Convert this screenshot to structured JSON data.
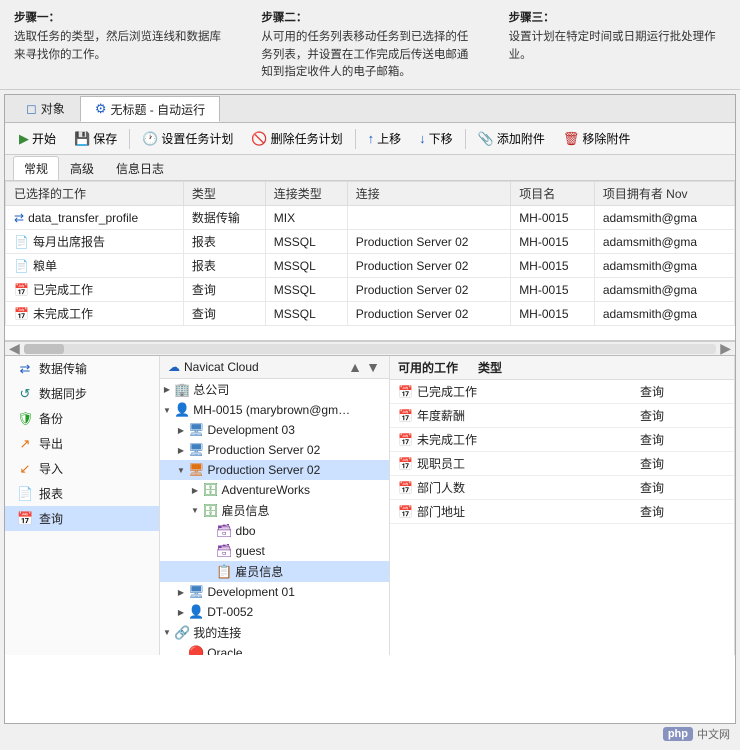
{
  "steps": [
    {
      "title": "步骤一：",
      "desc": "选取任务的类型，然后浏览连线和数据库来寻找你的工作。"
    },
    {
      "title": "步骤二：",
      "desc": "从可用的任务列表移动任务到已选择的任务列表，并设置在工作完成后传送电邮通知到指定收件人的电子邮箱。"
    },
    {
      "title": "步骤三：",
      "desc": "设置计划在特定时间或日期运行批处理作业。"
    }
  ],
  "tabs": [
    {
      "label": "对象",
      "icon": "◻"
    },
    {
      "label": "无标题 - 自动运行",
      "icon": "⚙"
    }
  ],
  "toolbar": {
    "buttons": [
      {
        "id": "start",
        "label": "开始",
        "icon": "▶"
      },
      {
        "id": "save",
        "label": "保存",
        "icon": "💾"
      },
      {
        "id": "set-schedule",
        "label": "设置任务计划",
        "icon": "🕐"
      },
      {
        "id": "del-schedule",
        "label": "删除任务计划",
        "icon": "🚫"
      },
      {
        "id": "move-up",
        "label": "上移",
        "icon": "↑"
      },
      {
        "id": "move-down",
        "label": "下移",
        "icon": "↓"
      },
      {
        "id": "add-attach",
        "label": "添加附件",
        "icon": "📎"
      },
      {
        "id": "remove-attach",
        "label": "移除附件",
        "icon": "🗑"
      }
    ]
  },
  "sub_tabs": [
    {
      "label": "常规",
      "active": true
    },
    {
      "label": "高级"
    },
    {
      "label": "信息日志"
    }
  ],
  "task_table": {
    "headers": [
      "已选择的工作",
      "类型",
      "连接类型",
      "连接",
      "项目名",
      "项目拥有者 Nov"
    ],
    "rows": [
      {
        "name": "data_transfer_profile",
        "type": "数据传输",
        "conn_type": "MIX",
        "connection": "",
        "project": "MH-0015",
        "owner": "adamsmith@gma",
        "icon": "transfer"
      },
      {
        "name": "每月出席报告",
        "type": "报表",
        "conn_type": "MSSQL",
        "connection": "Production Server 02",
        "project": "MH-0015",
        "owner": "adamsmith@gma",
        "icon": "report"
      },
      {
        "name": "粮单",
        "type": "报表",
        "conn_type": "MSSQL",
        "connection": "Production Server 02",
        "project": "MH-0015",
        "owner": "adamsmith@gma",
        "icon": "report"
      },
      {
        "name": "已完成工作",
        "type": "查询",
        "conn_type": "MSSQL",
        "connection": "Production Server 02",
        "project": "MH-0015",
        "owner": "adamsmith@gma",
        "icon": "query"
      },
      {
        "name": "未完成工作",
        "type": "查询",
        "conn_type": "MSSQL",
        "connection": "Production Server 02",
        "project": "MH-0015",
        "owner": "adamsmith@gma",
        "icon": "query"
      }
    ]
  },
  "sidebar": {
    "items": [
      {
        "id": "data-transfer",
        "label": "数据传输",
        "icon": "⇄",
        "selected": false
      },
      {
        "id": "data-sync",
        "label": "数据同步",
        "icon": "↺",
        "selected": false
      },
      {
        "id": "backup",
        "label": "备份",
        "icon": "🛡",
        "selected": false
      },
      {
        "id": "export",
        "label": "导出",
        "icon": "↗",
        "selected": false
      },
      {
        "id": "import",
        "label": "导入",
        "icon": "↙",
        "selected": false
      },
      {
        "id": "report",
        "label": "报表",
        "icon": "📄",
        "selected": false
      },
      {
        "id": "query",
        "label": "查询",
        "icon": "📅",
        "selected": true
      }
    ]
  },
  "tree": {
    "header": "Navicat Cloud",
    "nodes": [
      {
        "label": "总公司",
        "level": 1,
        "expanded": false,
        "icon": "🏢",
        "type": "company"
      },
      {
        "label": "MH-0015 (marybrown@gm…",
        "level": 1,
        "expanded": true,
        "icon": "👤",
        "type": "user"
      },
      {
        "label": "Development 03",
        "level": 2,
        "expanded": false,
        "icon": "🖥",
        "type": "server"
      },
      {
        "label": "Production Server 02",
        "level": 2,
        "expanded": false,
        "icon": "🖥",
        "type": "server"
      },
      {
        "label": "Production Server 02",
        "level": 2,
        "expanded": true,
        "icon": "🖥",
        "type": "server-active",
        "selected": true
      },
      {
        "label": "AdventureWorks",
        "level": 3,
        "expanded": false,
        "icon": "🗄",
        "type": "db"
      },
      {
        "label": "雇员信息",
        "level": 3,
        "expanded": true,
        "icon": "🗄",
        "type": "db"
      },
      {
        "label": "dbo",
        "level": 4,
        "expanded": false,
        "icon": "🗃",
        "type": "schema"
      },
      {
        "label": "guest",
        "level": 4,
        "expanded": false,
        "icon": "🗃",
        "type": "schema"
      },
      {
        "label": "雇员信息",
        "level": 4,
        "expanded": false,
        "icon": "📋",
        "type": "table",
        "selected": true
      },
      {
        "label": "Development 01",
        "level": 2,
        "expanded": false,
        "icon": "🖥",
        "type": "server"
      },
      {
        "label": "DT-0052",
        "level": 2,
        "expanded": false,
        "icon": "👤",
        "type": "user"
      },
      {
        "label": "我的连接",
        "level": 1,
        "expanded": true,
        "icon": "🔗",
        "type": "group"
      },
      {
        "label": "Oracle",
        "level": 2,
        "expanded": false,
        "icon": "🔴",
        "type": "oracle"
      }
    ]
  },
  "available_tasks": {
    "headers": [
      "可用的工作",
      "类型"
    ],
    "rows": [
      {
        "name": "已完成工作",
        "type": "查询",
        "icon": "query"
      },
      {
        "name": "年度薪酬",
        "type": "查询",
        "icon": "query"
      },
      {
        "name": "未完成工作",
        "type": "查询",
        "icon": "query"
      },
      {
        "name": "现职员工",
        "type": "查询",
        "icon": "query"
      },
      {
        "name": "部门人数",
        "type": "查询",
        "icon": "query"
      },
      {
        "name": "部门地址",
        "type": "查询",
        "icon": "query"
      }
    ]
  },
  "php_logo": {
    "badge": "php",
    "label": "中文网"
  }
}
